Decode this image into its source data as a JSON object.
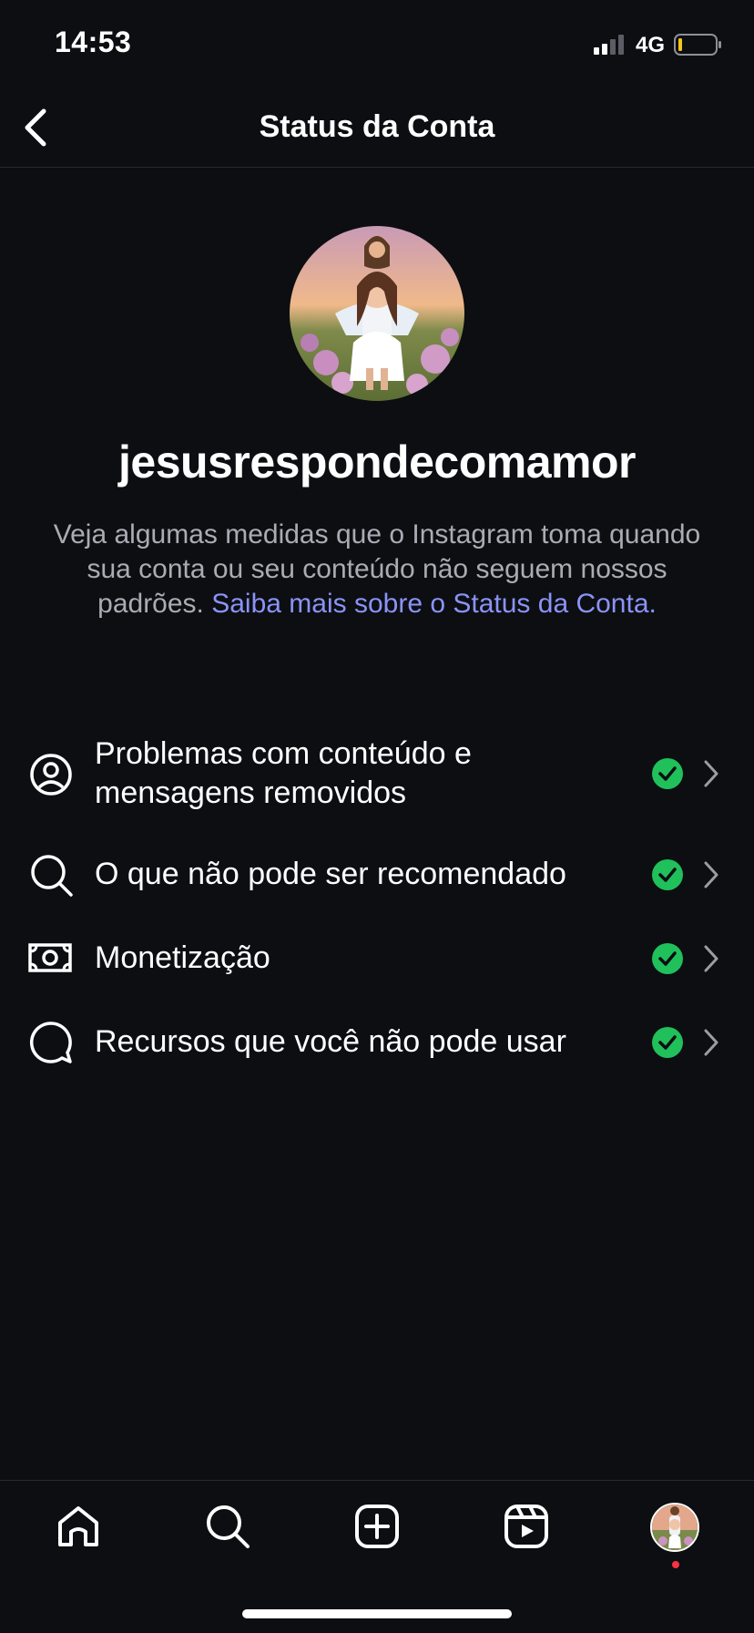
{
  "status_bar": {
    "time": "14:53",
    "network": "4G"
  },
  "header": {
    "title": "Status da Conta",
    "back_icon": "chevron-left-icon"
  },
  "profile": {
    "username": "jesusrespondecomamor",
    "description": "Veja algumas medidas que o Instagram toma quando sua conta ou seu conteúdo não seguem nossos padrões. ",
    "link": "Saiba mais sobre o Status da Conta."
  },
  "items": [
    {
      "icon": "user-circle-icon",
      "label_line1": "Problemas com conteúdo e",
      "label_line2": "mensagens removidos",
      "status": "ok"
    },
    {
      "icon": "search-icon",
      "label": "O que não pode ser recomendado",
      "status": "ok"
    },
    {
      "icon": "banknote-icon",
      "label": "Monetização",
      "status": "ok"
    },
    {
      "icon": "chat-bubble-icon",
      "label": "Recursos que você não pode usar",
      "status": "ok"
    }
  ],
  "tabbar": [
    "home-icon",
    "search-icon",
    "create-icon",
    "reels-icon",
    "profile-avatar"
  ],
  "colors": {
    "background": "#0c0e12",
    "link": "#8b93f6",
    "ok": "#20c05b",
    "notification": "#ff3040"
  }
}
